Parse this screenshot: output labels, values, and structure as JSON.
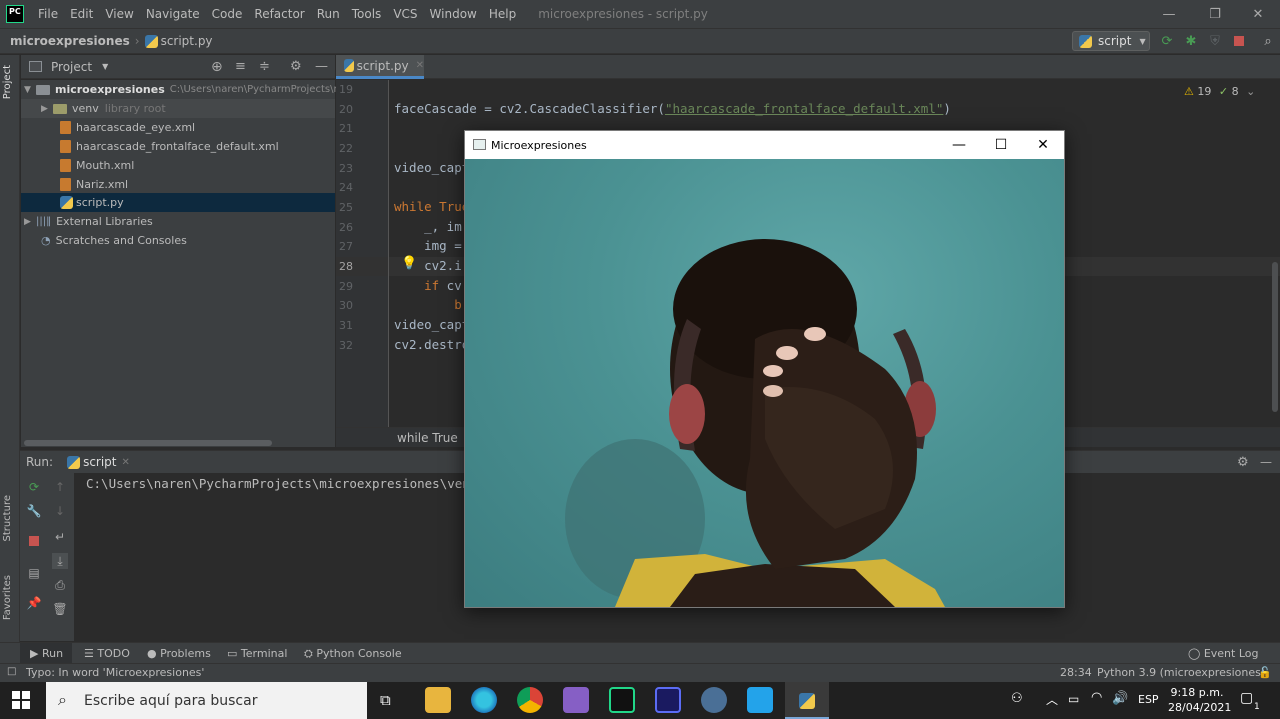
{
  "app": {
    "logo_text": "PC",
    "window_title": "microexpresiones - script.py"
  },
  "menu": [
    "File",
    "Edit",
    "View",
    "Navigate",
    "Code",
    "Refactor",
    "Run",
    "Tools",
    "VCS",
    "Window",
    "Help"
  ],
  "nav": {
    "project": "microexpresiones",
    "file": "script.py",
    "run_config": "script"
  },
  "project_panel": {
    "title": "Project",
    "root_name": "microexpresiones",
    "root_path": "C:\\Users\\naren\\PycharmProjects\\m",
    "venv": "venv",
    "venv_note": "library root",
    "files": [
      "haarcascade_eye.xml",
      "haarcascade_frontalface_default.xml",
      "Mouth.xml",
      "Nariz.xml",
      "script.py"
    ],
    "external": "External Libraries",
    "scratches": "Scratches and Consoles"
  },
  "side_tabs": {
    "project": "Project",
    "structure": "Structure",
    "favorites": "Favorites"
  },
  "editor": {
    "tab": "script.py",
    "warnings": "19",
    "weak_warnings": "8",
    "lines": [
      {
        "n": "19",
        "pre": "",
        "kw": "",
        "text": ""
      },
      {
        "n": "20",
        "pre": "faceCascade = cv2.CascadeClassifier(",
        "kw": "",
        "str": "\"haarcascade_frontalface_default.xml\"",
        "post": ")"
      },
      {
        "n": "21",
        "text": ""
      },
      {
        "n": "22",
        "text": ""
      },
      {
        "n": "23",
        "text": "video_capt"
      },
      {
        "n": "24",
        "text": ""
      },
      {
        "n": "25",
        "kw": "while",
        "text": " True"
      },
      {
        "n": "26",
        "text": "    _, im"
      },
      {
        "n": "27",
        "text": "    img ="
      },
      {
        "n": "28",
        "text": "    cv2.i"
      },
      {
        "n": "29",
        "kw": "    if",
        "text": " cv"
      },
      {
        "n": "30",
        "text": "        b"
      },
      {
        "n": "31",
        "text": "video_capt"
      },
      {
        "n": "32",
        "text": "cv2.destro"
      }
    ],
    "breadcrumb": "while True"
  },
  "run": {
    "label": "Run:",
    "tab": "script",
    "output": "C:\\Users\\naren\\PycharmProjects\\microexpresiones\\ven"
  },
  "bottom_tabs": [
    "Run",
    "TODO",
    "Problems",
    "Terminal",
    "Python Console"
  ],
  "event_log": "Event Log",
  "status": {
    "message": "Typo: In word 'Microexpresiones'",
    "position": "28:34",
    "interpreter": "Python 3.9 (microexpresiones)"
  },
  "camera_window": {
    "title": "Microexpresiones"
  },
  "taskbar": {
    "search_placeholder": "Escribe aquí para buscar",
    "lang": "ESP",
    "time": "9:18 p.m.",
    "date": "28/04/2021",
    "notifications": "1"
  },
  "colors": {
    "accent": "#4a88c7",
    "keyword": "#cc7832",
    "string": "#6a8759",
    "code": "#a9b7c6"
  }
}
